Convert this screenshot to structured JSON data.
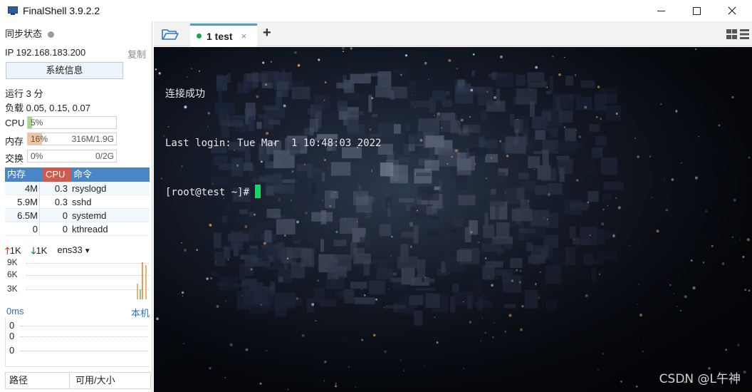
{
  "window": {
    "title": "FinalShell 3.9.2.2"
  },
  "sidebar": {
    "sync_label": "同步状态",
    "ip_label": "IP 192.168.183.200",
    "copy_label": "复制",
    "sysinfo_button": "系统信息",
    "uptime": "运行 3 分",
    "load": "负载 0.05, 0.15, 0.07",
    "cpu": {
      "label": "CPU",
      "percent_text": "5%",
      "fraction": 0.05,
      "color": "#a6d88a"
    },
    "memory": {
      "label": "内存",
      "percent_text": "16%",
      "amount": "316M/1.9G",
      "fraction": 0.16,
      "color": "#f4c39a"
    },
    "swap": {
      "label": "交换",
      "percent_text": "0%",
      "amount": "0/2G",
      "fraction": 0,
      "color": "#cfe3f4"
    },
    "process_table": {
      "headers": {
        "mem": "内存",
        "cpu": "CPU",
        "cmd": "命令"
      },
      "rows": [
        {
          "mem": "4M",
          "cpu": "0.3",
          "cmd": "rsyslogd"
        },
        {
          "mem": "5.9M",
          "cpu": "0.3",
          "cmd": "sshd"
        },
        {
          "mem": "6.5M",
          "cpu": "0",
          "cmd": "systemd"
        },
        {
          "mem": "0",
          "cpu": "0",
          "cmd": "kthreadd"
        }
      ]
    },
    "network": {
      "up": "1K",
      "down": "1K",
      "interface": "ens33",
      "axis": [
        "9K",
        "6K",
        "3K"
      ]
    },
    "latency": {
      "label": "0ms",
      "host": "本机",
      "axis": [
        "0",
        "0",
        "0"
      ]
    },
    "path_table": {
      "col_path": "路径",
      "col_avail": "可用/大小"
    }
  },
  "tabs": {
    "items": [
      {
        "label": "1 test",
        "close": "×",
        "connected": true
      }
    ],
    "add": "+"
  },
  "terminal": {
    "lines": [
      "连接成功",
      "Last login: Tue Mar  1 10:48:03 2022",
      "[root@test ~]# "
    ],
    "watermark": "CSDN @L午神"
  },
  "colors": {
    "tab_accent": "#4a9ed8",
    "connected_dot": "#1aa54a",
    "cursor": "#19d36a",
    "proc_header_blue": "#4a86c5",
    "proc_header_red": "#cf5b4f"
  }
}
